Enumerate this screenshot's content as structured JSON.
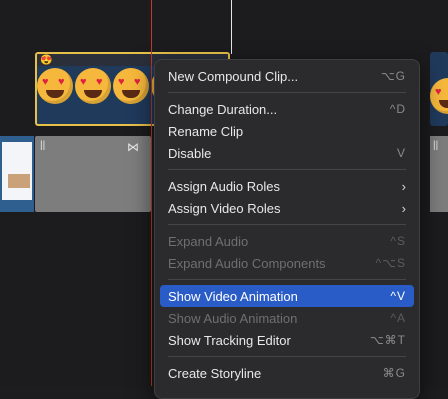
{
  "timeline": {
    "selected_clip": {
      "emoji": "😍"
    },
    "track_icons": {
      "pause_left": "||",
      "bowtie": "⋈",
      "pause_right": "||"
    }
  },
  "menu": {
    "items": [
      {
        "label": "New Compound Clip...",
        "shortcut": "⌥G",
        "state": "enabled"
      },
      {
        "sep": true
      },
      {
        "label": "Change Duration...",
        "shortcut": "^D",
        "state": "enabled"
      },
      {
        "label": "Rename Clip",
        "shortcut": "",
        "state": "enabled"
      },
      {
        "label": "Disable",
        "shortcut": "V",
        "state": "enabled"
      },
      {
        "sep": true
      },
      {
        "label": "Assign Audio Roles",
        "shortcut": "›",
        "state": "submenu"
      },
      {
        "label": "Assign Video Roles",
        "shortcut": "›",
        "state": "submenu"
      },
      {
        "sep": true
      },
      {
        "label": "Expand Audio",
        "shortcut": "^S",
        "state": "disabled"
      },
      {
        "label": "Expand Audio Components",
        "shortcut": "^⌥S",
        "state": "disabled"
      },
      {
        "sep": true
      },
      {
        "label": "Show Video Animation",
        "shortcut": "^V",
        "state": "highlight"
      },
      {
        "label": "Show Audio Animation",
        "shortcut": "^A",
        "state": "disabled"
      },
      {
        "label": "Show Tracking Editor",
        "shortcut": "⌥⌘T",
        "state": "enabled"
      },
      {
        "sep": true
      },
      {
        "label": "Create Storyline",
        "shortcut": "⌘G",
        "state": "enabled"
      }
    ]
  },
  "colors": {
    "highlight": "#2a5cc7",
    "selection_border": "#e6c14a",
    "playhead": "#c0392b"
  }
}
